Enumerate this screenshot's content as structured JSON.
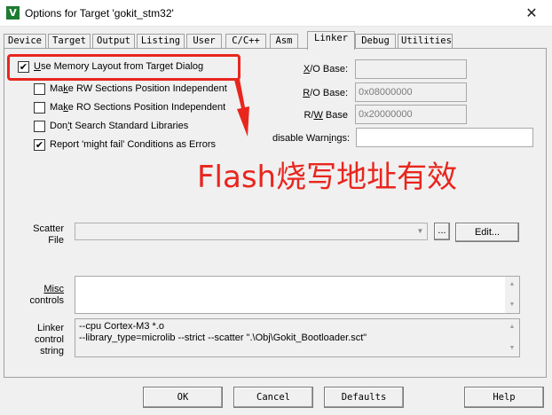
{
  "window": {
    "title": "Options for Target 'gokit_stm32'",
    "app_icon": "V",
    "close_glyph": "✕"
  },
  "tabs": [
    {
      "label": "Device"
    },
    {
      "label": "Target"
    },
    {
      "label": "Output"
    },
    {
      "label": "Listing"
    },
    {
      "label": "User"
    },
    {
      "label": "C/C++"
    },
    {
      "label": "Asm"
    },
    {
      "label": "Linker",
      "active": true
    },
    {
      "label": "Debug"
    },
    {
      "label": "Utilities"
    }
  ],
  "checkboxes": {
    "use_memory_layout": {
      "label_pre": "",
      "label_u": "U",
      "label_post": "se Memory Layout from Target Dialog",
      "checked": true
    },
    "make_rw": {
      "label_pre": "Ma",
      "label_u": "k",
      "label_post": "e RW Sections Position Independent",
      "checked": false
    },
    "make_ro": {
      "label_pre": "Ma",
      "label_u": "k",
      "label_post": "e RO Sections Position Independent",
      "checked": false
    },
    "dont_search": {
      "label_pre": "Don",
      "label_u": "'",
      "label_post": "t Search Standard Libraries",
      "checked": false
    },
    "might_fail": {
      "label_pre": "Report 'might fail' Conditions as Errors",
      "label_u": "",
      "label_post": "",
      "checked": true
    }
  },
  "fields": {
    "xo_base": {
      "label_u": "X",
      "label_post": "/O Base:",
      "value": ""
    },
    "ro_base": {
      "label_u": "R",
      "label_post": "/O Base:",
      "value": "0x08000000"
    },
    "rw_base": {
      "label_pre": "R/",
      "label_u": "W",
      "label_post": " Base",
      "value": "0x20000000"
    },
    "disable_warnings": {
      "label_pre": "disable Warn",
      "label_u": "i",
      "label_post": "ngs:",
      "value": ""
    }
  },
  "annotation": {
    "text": "Flash烧写地址有效",
    "color": "#e8261e"
  },
  "scatter": {
    "label_line1": "Scatter",
    "label_line2": "File",
    "value": "",
    "browse_label": "...",
    "edit_label": "Edit..."
  },
  "misc": {
    "label_line1": "Misc",
    "label_line2": "controls",
    "value": ""
  },
  "linker": {
    "label_line1": "Linker",
    "label_line2": "control",
    "label_line3": "string",
    "text": "--cpu Cortex-M3 *.o\n--library_type=microlib --strict --scatter \".\\Obj\\Gokit_Bootloader.sct\""
  },
  "buttons": {
    "ok": "OK",
    "cancel": "Cancel",
    "defaults": "Defaults",
    "help": "Help"
  }
}
